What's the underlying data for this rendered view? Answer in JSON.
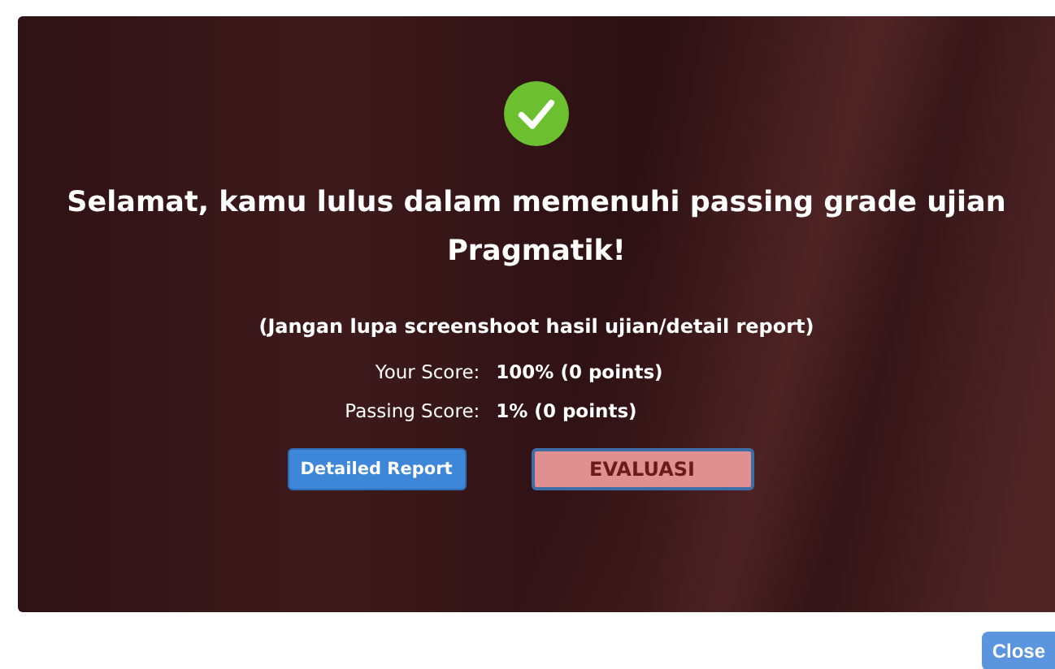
{
  "result_panel": {
    "passed": true,
    "heading": "Selamat, kamu lulus dalam memenuhi passing grade ujian Pragmatik!",
    "note": "(Jangan lupa screenshoot hasil ujian/detail report)",
    "scores": [
      {
        "label": "Your Score:",
        "value": "100% (0 points)"
      },
      {
        "label": "Passing Score:",
        "value": "1% (0 points)"
      }
    ],
    "buttons": [
      {
        "label": "Detailed Report",
        "kind": "primary"
      },
      {
        "label": "EVALUASI",
        "kind": "evaluation"
      }
    ]
  },
  "footer": {
    "close_button": "Close"
  }
}
